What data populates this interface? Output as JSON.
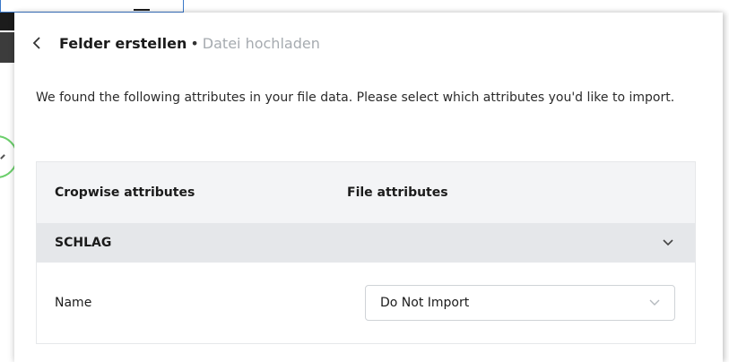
{
  "header": {
    "title": "Felder erstellen",
    "separator": "•",
    "subtitle": "Datei hochladen",
    "back_icon": "chevron-left-icon"
  },
  "description": "We found the following attributes in your file data. Please select which attributes you'd like to import.",
  "table": {
    "columns": [
      "Cropwise attributes",
      "File attributes"
    ],
    "group": {
      "label": "SCHLAG",
      "icon": "chevron-down-icon"
    },
    "rows": [
      {
        "name": "Name",
        "selected": "Do Not Import",
        "icon": "chevron-down-icon"
      }
    ]
  },
  "colors": {
    "header_bg": "#f3f4f6",
    "group_bg": "#e5e7ea",
    "subtitle": "#a6abb0",
    "highlight_circle": "#6ccf6c",
    "frame_border": "#3a78c9"
  }
}
